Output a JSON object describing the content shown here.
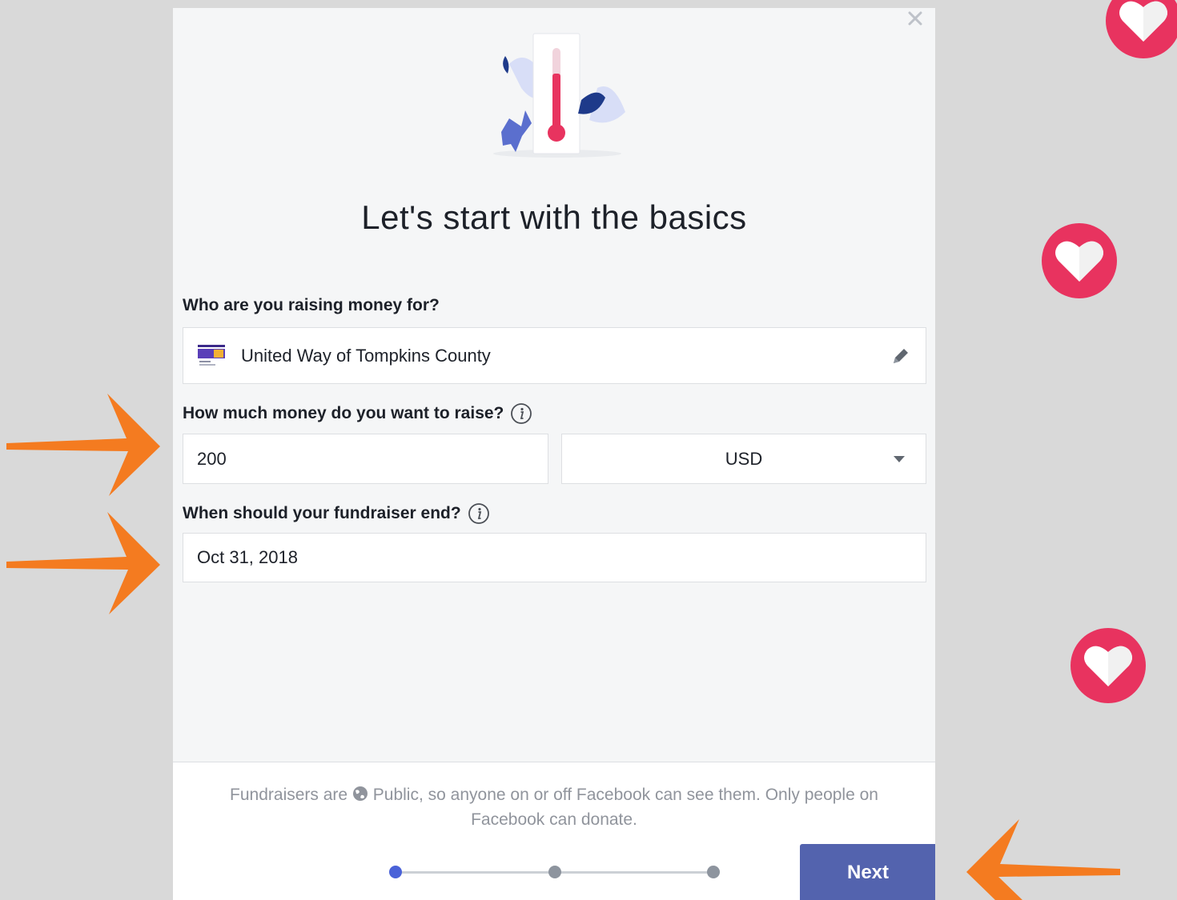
{
  "dialog": {
    "title": "Let's start with the basics",
    "close_icon": "close-icon"
  },
  "recipient": {
    "label": "Who are you raising money for?",
    "value": "United Way of Tompkins County",
    "edit_icon": "pencil-icon"
  },
  "goal": {
    "label": "How much money do you want to raise?",
    "amount_value": "200",
    "currency_value": "USD"
  },
  "end_date": {
    "label": "When should your fundraiser end?",
    "value": "Oct 31, 2018"
  },
  "footer": {
    "notice_prefix": "Fundraisers are",
    "notice_suffix": "Public, so anyone on or off Facebook can see them. Only people on Facebook can donate.",
    "next_label": "Next",
    "steps_total": 3,
    "step_current": 1
  },
  "colors": {
    "background": "#d9d9d9",
    "accent": "#5363ae",
    "active_step": "#4a62d8",
    "heart": "#e8335f",
    "arrow": "#f47b20"
  }
}
